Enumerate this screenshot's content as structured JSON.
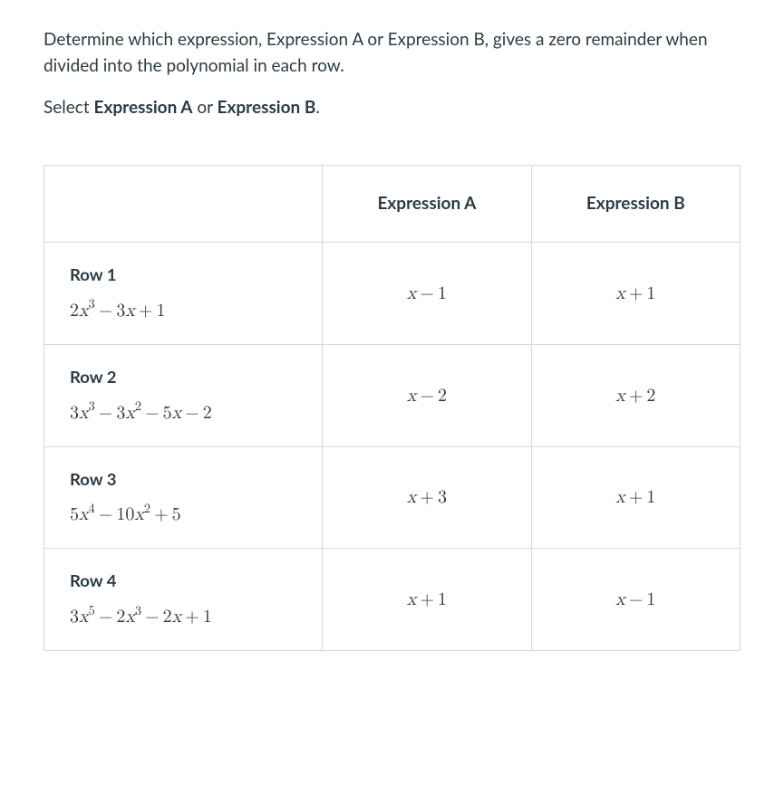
{
  "intro": "Determine which expression, Expression A or Expression B, gives a zero remainder when divided into the polynomial in each row.",
  "select_line_prefix": "Select ",
  "select_line_a": "Expression A",
  "select_line_mid": " or ",
  "select_line_b": "Expression B",
  "select_line_suffix": ".",
  "headers": {
    "blank": "",
    "col_a": "Expression A",
    "col_b": "Expression B"
  },
  "rows": [
    {
      "label": "Row 1",
      "poly_html": "<span class=\"num\">2</span>x<sup>3</sup><span class=\"op\">−</span><span class=\"num\">3</span>x<span class=\"op\">+</span><span class=\"num\">1</span>",
      "expr_a_html": "x<span class=\"op\">−</span><span class=\"num\">1</span>",
      "expr_b_html": "x<span class=\"op\">+</span><span class=\"num\">1</span>"
    },
    {
      "label": "Row 2",
      "poly_html": "<span class=\"num\">3</span>x<sup>3</sup><span class=\"op\">−</span><span class=\"num\">3</span>x<sup>2</sup><span class=\"op\">−</span><span class=\"num\">5</span>x<span class=\"op\">−</span><span class=\"num\">2</span>",
      "expr_a_html": "x<span class=\"op\">−</span><span class=\"num\">2</span>",
      "expr_b_html": "x<span class=\"op\">+</span><span class=\"num\">2</span>"
    },
    {
      "label": "Row 3",
      "poly_html": "<span class=\"num\">5</span>x<sup>4</sup><span class=\"op\">−</span><span class=\"num\">10</span>x<sup>2</sup><span class=\"op\">+</span><span class=\"num\">5</span>",
      "expr_a_html": "x<span class=\"op\">+</span><span class=\"num\">3</span>",
      "expr_b_html": "x<span class=\"op\">+</span><span class=\"num\">1</span>"
    },
    {
      "label": "Row 4",
      "poly_html": "<span class=\"num\">3</span>x<sup>5</sup><span class=\"op\">−</span><span class=\"num\">2</span>x<sup>3</sup><span class=\"op\">−</span><span class=\"num\">2</span>x<span class=\"op\">+</span><span class=\"num\">1</span>",
      "expr_a_html": "x<span class=\"op\">+</span><span class=\"num\">1</span>",
      "expr_b_html": "x<span class=\"op\">−</span><span class=\"num\">1</span>"
    }
  ]
}
